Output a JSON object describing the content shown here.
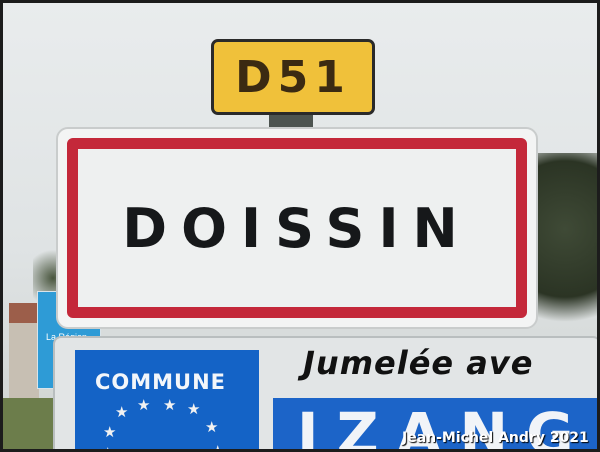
{
  "scene": {
    "route_plate": {
      "text": "D51",
      "color": "#f0c13a"
    },
    "main_sign": {
      "text": "DOISSIN",
      "border_color": "#c4283a"
    },
    "region_sign": {
      "text": "La Région"
    },
    "lower_sign": {
      "commune_label": "COMMUNE",
      "twin_line": "Jumelée ave",
      "twin_name": "IZANG",
      "eu_blue": "#1463c6"
    },
    "credit": "Jean-Michel Andry 2021"
  }
}
